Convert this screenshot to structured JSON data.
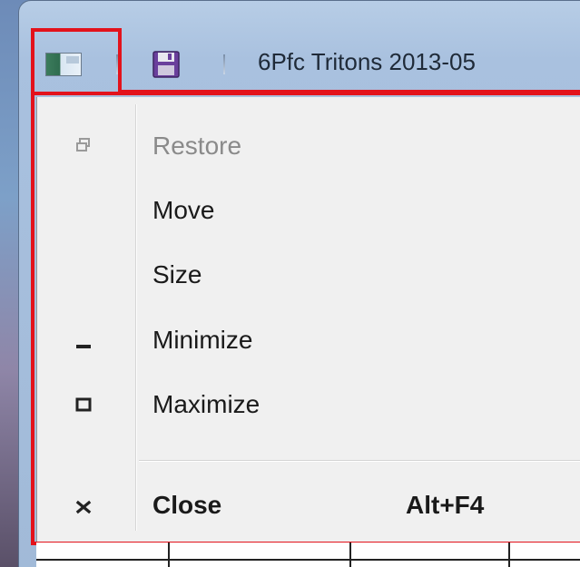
{
  "window": {
    "title": "6Pfc Tritons 2013-05"
  },
  "icons": {
    "app": "app-window-icon",
    "save": "floppy-disk-icon",
    "restore": "restore-icon",
    "minimize": "minimize-icon",
    "maximize": "maximize-icon",
    "close": "close-icon"
  },
  "colors": {
    "highlight": "#e3121b",
    "disabled_text": "#8a8a8a",
    "menu_bg": "#f0f0f0"
  },
  "menu": {
    "items": [
      {
        "label": "Restore",
        "enabled": false,
        "icon": "restore-icon"
      },
      {
        "label": "Move",
        "enabled": true
      },
      {
        "label": "Size",
        "enabled": true
      },
      {
        "label": "Minimize",
        "enabled": true,
        "icon": "minimize-icon"
      },
      {
        "label": "Maximize",
        "enabled": true,
        "icon": "maximize-icon"
      },
      {
        "label": "Close",
        "enabled": true,
        "icon": "close-icon",
        "shortcut": "Alt+F4"
      }
    ]
  }
}
